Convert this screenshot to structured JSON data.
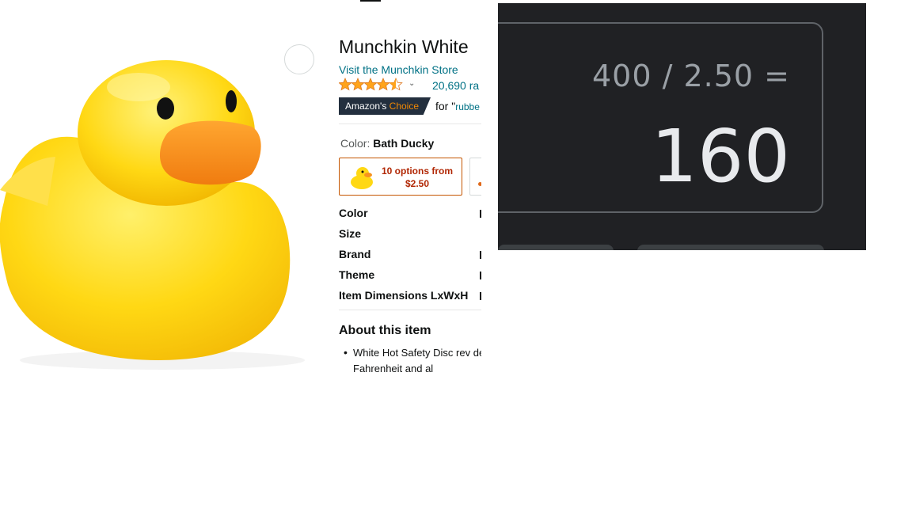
{
  "product": {
    "title": "Munchkin White",
    "store_link": "Visit the Munchkin Store",
    "rating_count": "20,690 ra",
    "badge_prefix": "Amazon's",
    "badge_suffix": "Choice",
    "badge_for": "for \"",
    "badge_keyword": "rubbe",
    "color_label": "Color:",
    "color_value": "Bath Ducky",
    "option_text": "10 options from $2.50",
    "specs": [
      "Color",
      "Size",
      "Brand",
      "Theme",
      "Item Dimensions LxWxH"
    ],
    "about_title": "About this item",
    "bullet_text": "White Hot Safety Disc rev degrees Fahrenheit and al",
    "rating_stars": 4.5
  },
  "calculator": {
    "expression": "400 / 2.50 =",
    "result": "160"
  },
  "colors": {
    "link": "#007185",
    "price_red": "#B12704",
    "badge_bg": "#232F3E",
    "badge_orange": "#F08804",
    "calc_bg": "#202124",
    "duck_yellow": "#FFD21F",
    "beak_orange": "#F7931E"
  },
  "icons": {
    "share": "share-icon",
    "stars": "star-rating-icon",
    "chevron": "chevron-down-icon"
  }
}
